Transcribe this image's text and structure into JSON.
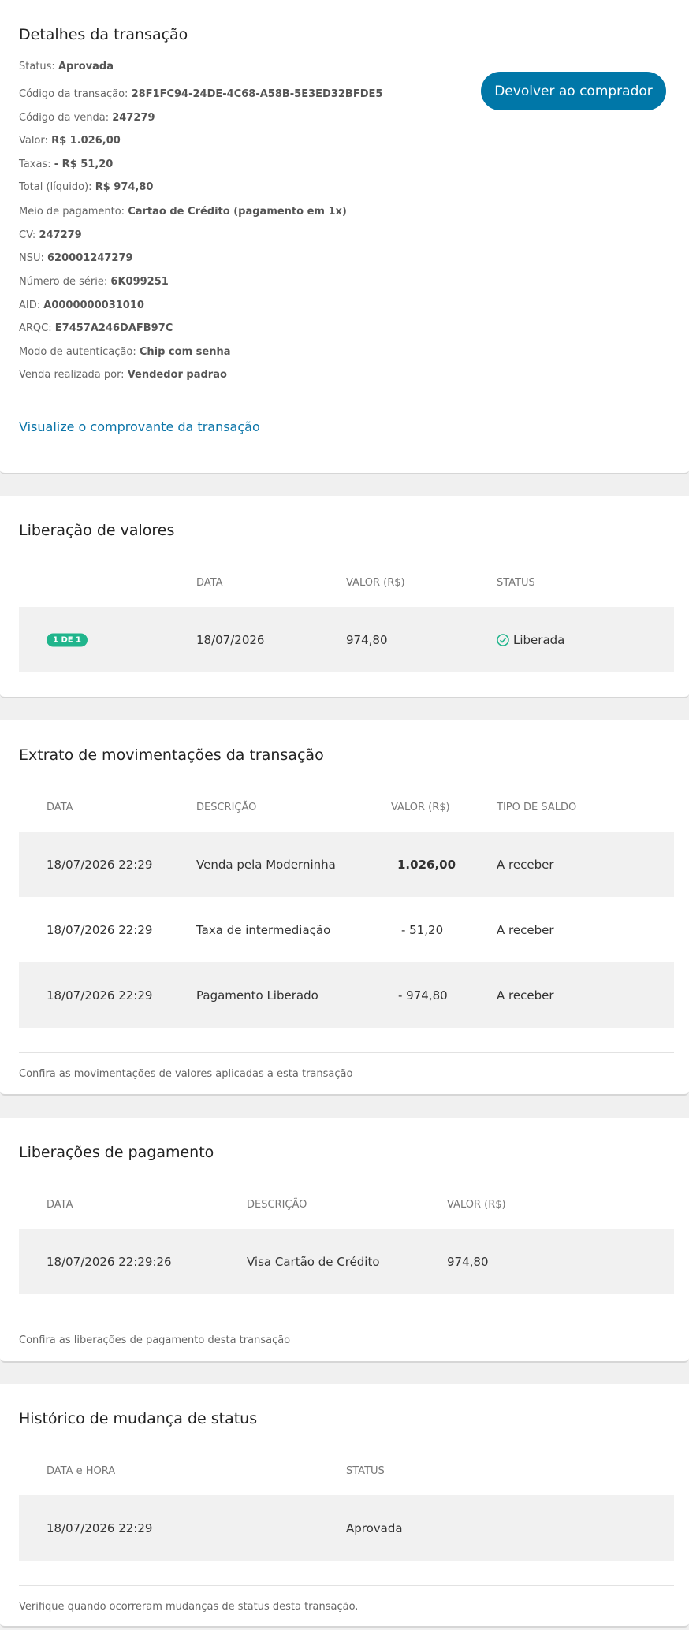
{
  "details": {
    "title": "Detalhes da transação",
    "fields": [
      {
        "label": "Status:",
        "value": "Aprovada"
      },
      {
        "label": "Código da transação:",
        "value": "28F1FC94-24DE-4C68-A58B-5E3ED32BFDE5"
      },
      {
        "label": "Código da venda:",
        "value": "247279"
      },
      {
        "label": "Valor:",
        "value": "R$ 1.026,00"
      },
      {
        "label": "Taxas:",
        "value": "- R$ 51,20"
      },
      {
        "label": "Total (líquido):",
        "value": "R$ 974,80"
      },
      {
        "label": "Meio de pagamento:",
        "value": "Cartão de Crédito (pagamento em 1x)"
      },
      {
        "label": "CV:",
        "value": "247279"
      },
      {
        "label": "NSU:",
        "value": "620001247279"
      },
      {
        "label": "Número de série:",
        "value": "6K099251"
      },
      {
        "label": "AID:",
        "value": "A0000000031010"
      },
      {
        "label": "ARQC:",
        "value": "E7457A246DAFB97C"
      },
      {
        "label": "Modo de autenticação:",
        "value": "Chip com senha"
      },
      {
        "label": "Venda realizada por:",
        "value": "Vendedor padrão"
      }
    ],
    "refund_button": "Devolver ao comprador",
    "receipt_link": "Visualize o comprovante da transação"
  },
  "release": {
    "title": "Liberação de valores",
    "headers": [
      "DATA",
      "VALOR (R$)",
      "STATUS"
    ],
    "rows": [
      {
        "badge": "1 DE 1",
        "date": "18/07/2026",
        "value": "974,80",
        "status": "Liberada",
        "status_icon": "check-circle-icon"
      }
    ]
  },
  "statement": {
    "title": "Extrato de movimentações da transação",
    "headers": [
      "DATA",
      "DESCRIÇÃO",
      "VALOR (R$)",
      "TIPO DE SALDO"
    ],
    "rows": [
      {
        "date": "18/07/2026 22:29",
        "description": "Venda pela Moderninha",
        "value": "1.026,00",
        "balance": "A receber"
      },
      {
        "date": "18/07/2026 22:29",
        "description": "Taxa de intermediação",
        "value": "- 51,20",
        "balance": "A receber"
      },
      {
        "date": "18/07/2026 22:29",
        "description": "Pagamento Liberado",
        "value": "- 974,80",
        "balance": "A receber"
      }
    ],
    "footnote": "Confira as movimentações de valores aplicadas a esta transação"
  },
  "payments": {
    "title": "Liberações de pagamento",
    "headers": [
      "DATA",
      "DESCRIÇÃO",
      "VALOR (R$)"
    ],
    "rows": [
      {
        "date": "18/07/2026 22:29:26",
        "description": "Visa Cartão de Crédito",
        "value": "974,80"
      }
    ],
    "footnote": "Confira as liberações de pagamento desta transação"
  },
  "history": {
    "title": "Histórico de mudança de status",
    "headers": [
      "DATA e HORA",
      "STATUS"
    ],
    "rows": [
      {
        "datetime": "18/07/2026 22:29",
        "status": "Aprovada"
      }
    ],
    "footnote": "Verifique quando ocorreram mudanças de status desta transação."
  },
  "colors": {
    "accent": "#0077a8",
    "badge": "#20b58c",
    "row_shade": "#f1f1f1"
  }
}
